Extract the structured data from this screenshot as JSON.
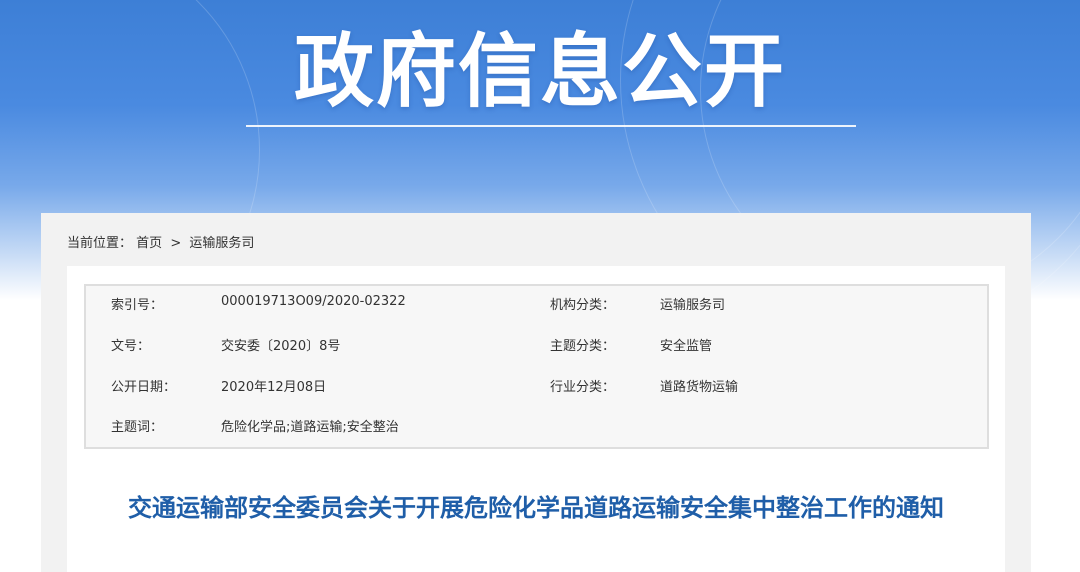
{
  "banner": {
    "title": "政府信息公开"
  },
  "breadcrumb": {
    "prefix": "当前位置：",
    "home": "首页",
    "separator": ">",
    "current": "运输服务司"
  },
  "meta": {
    "index_no_label": "索引号：",
    "index_no": "000019713O09/2020-02322",
    "org_label": "机构分类：",
    "org": "运输服务司",
    "doc_no_label": "文号：",
    "doc_no": "交安委〔2020〕8号",
    "topic_label": "主题分类：",
    "topic": "安全监管",
    "date_label": "公开日期：",
    "date": "2020年12月08日",
    "industry_label": "行业分类：",
    "industry": "道路货物运输",
    "keywords_label": "主题词：",
    "keywords": "危险化学品;道路运输;安全整治"
  },
  "document": {
    "title": "交通运输部安全委员会关于开展危险化学品道路运输安全集中整治工作的通知"
  }
}
